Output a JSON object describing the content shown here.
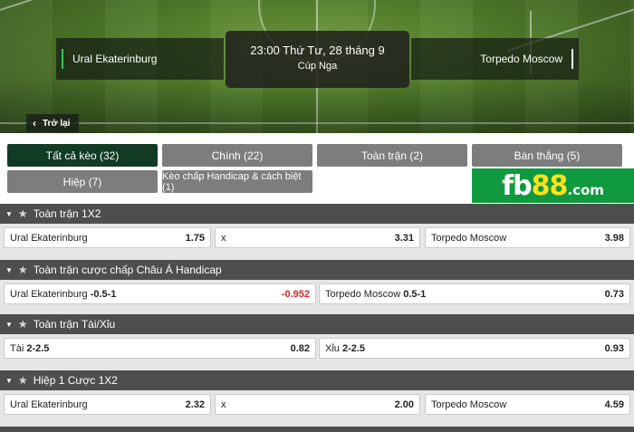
{
  "match": {
    "home_team": "Ural Ekaterinburg",
    "away_team": "Torpedo Moscow",
    "datetime": "23:00 Thứ Tư, 28 tháng 9",
    "league": "Cúp Nga"
  },
  "nav": {
    "back_label": "Trở lại"
  },
  "filters": [
    {
      "label": "Tất cả kèo (32)",
      "active": true
    },
    {
      "label": "Chính (22)"
    },
    {
      "label": "Toàn trận (2)"
    },
    {
      "label": "Bàn thắng (5)"
    },
    {
      "label": "Hiệp (7)"
    },
    {
      "label": "Kèo chấp Handicap & cách biệt (1)"
    }
  ],
  "logo": {
    "part1": "fb",
    "part2": "88",
    "part3": ".com"
  },
  "markets": [
    {
      "title": "Toàn trận 1X2",
      "odds": [
        {
          "name": "Ural Ekaterinburg",
          "line": "",
          "price": "1.75"
        },
        {
          "name": "x",
          "line": "",
          "price": "3.31"
        },
        {
          "name": "Torpedo Moscow",
          "line": "",
          "price": "3.98"
        }
      ]
    },
    {
      "title": "Toàn trận cược chấp Châu Á Handicap",
      "odds": [
        {
          "name": "Ural Ekaterinburg",
          "line": "-0.5-1",
          "price": "-0.952"
        },
        {
          "name": "Torpedo Moscow",
          "line": "0.5-1",
          "price": "0.73"
        }
      ]
    },
    {
      "title": "Toàn trận Tài/Xỉu",
      "odds": [
        {
          "name": "Tài",
          "line": "2-2.5",
          "price": "0.82"
        },
        {
          "name": "Xỉu",
          "line": "2-2.5",
          "price": "0.93"
        }
      ]
    },
    {
      "title": "Hiệp 1 Cược 1X2",
      "odds": [
        {
          "name": "Ural Ekaterinburg",
          "line": "",
          "price": "2.32"
        },
        {
          "name": "x",
          "line": "",
          "price": "2.00"
        },
        {
          "name": "Torpedo Moscow",
          "line": "",
          "price": "4.59"
        }
      ]
    }
  ],
  "colors": {
    "active_filter": "#123b25",
    "filter": "#7d7d7d",
    "header": "#4e4e4e",
    "negative": "#e02020",
    "logo_bg": "#0f9a3f"
  }
}
